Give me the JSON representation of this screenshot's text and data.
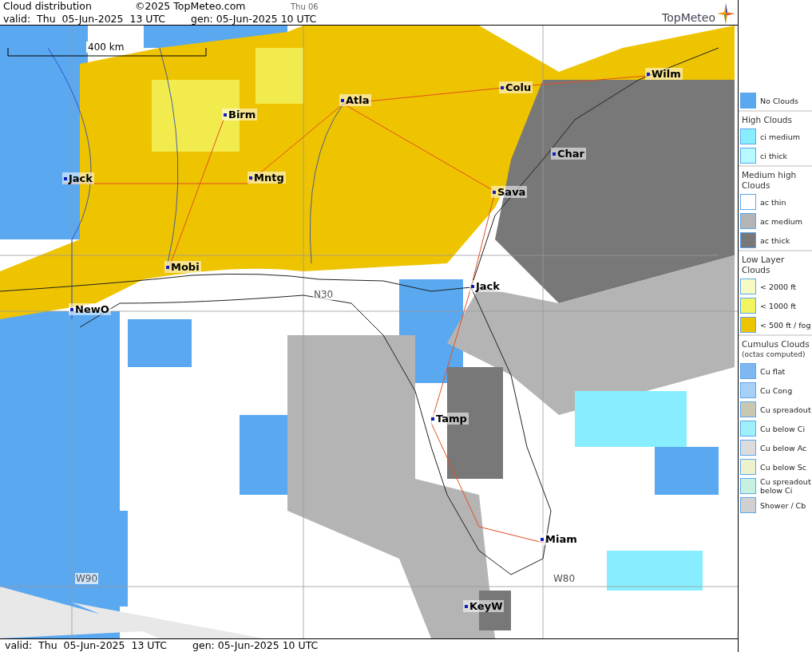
{
  "header": {
    "title": "Cloud distribution",
    "copyright": "©2025 TopMeteo.com",
    "day": "Thu 06",
    "valid": "valid:  Thu  05-Jun-2025  13 UTC",
    "gen": "gen: 05-Jun-2025 10 UTC",
    "logo": "TopMeteo"
  },
  "map": {
    "scale": "400 km",
    "grid_labels": [
      "N30",
      "W90",
      "W80"
    ],
    "cities": [
      "Wilm",
      "Colu",
      "Atla",
      "Birm",
      "Char",
      "Jack",
      "Mntg",
      "Sava",
      "Mobi",
      "Jack",
      "NewO",
      "Tamp",
      "Miam",
      "KeyW"
    ]
  },
  "legend": [
    {
      "kind": "swatch",
      "label": "No Clouds",
      "color": "#5aa8f0"
    },
    {
      "kind": "heading",
      "label": "High Clouds"
    },
    {
      "kind": "swatch",
      "label": "ci medium",
      "color": "#88eeff"
    },
    {
      "kind": "swatch",
      "label": "ci thick",
      "color": "#b8f8ff"
    },
    {
      "kind": "heading",
      "label": "Medium high Clouds"
    },
    {
      "kind": "swatch",
      "label": "ac thin",
      "color": "#ffffff"
    },
    {
      "kind": "swatch",
      "label": "ac medium",
      "color": "#b4b4b4"
    },
    {
      "kind": "swatch",
      "label": "ac thick",
      "color": "#787878"
    },
    {
      "kind": "heading",
      "label": "Low Layer Clouds"
    },
    {
      "kind": "swatch",
      "label": "< 2000 ft",
      "color": "#f6fbc4"
    },
    {
      "kind": "swatch",
      "label": "< 1000 ft",
      "color": "#f2f560"
    },
    {
      "kind": "swatch",
      "label": "< 500 ft / fog",
      "color": "#eec400"
    },
    {
      "kind": "heading",
      "label": "Cumulus Clouds",
      "note": "(octas computed)"
    },
    {
      "kind": "swatch",
      "label": "Cu flat",
      "color": "#7fb8f0"
    },
    {
      "kind": "swatch",
      "label": "Cu Cong",
      "color": "#a8d0f6"
    },
    {
      "kind": "swatch",
      "label": "Cu spreadout",
      "color": "#c8c8b0"
    },
    {
      "kind": "swatch",
      "label": "Cu below Ci",
      "color": "#9ef0fa"
    },
    {
      "kind": "swatch",
      "label": "Cu below Ac",
      "color": "#dcdcdc"
    },
    {
      "kind": "swatch",
      "label": "Cu below Sc",
      "color": "#eef2cc"
    },
    {
      "kind": "swatch",
      "label": "Cu spreadout below Ci",
      "color": "#c8f0e0"
    },
    {
      "kind": "swatch",
      "label": "Shower / Cb",
      "color": "#d0d0d0"
    }
  ],
  "footer": {
    "valid": "valid:  Thu  05-Jun-2025  13 UTC",
    "gen": "gen: 05-Jun-2025 10 UTC"
  }
}
